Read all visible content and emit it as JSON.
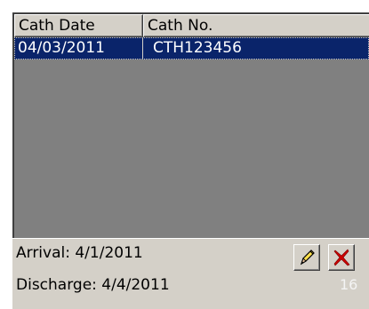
{
  "list": {
    "columns": [
      "Cath Date",
      "Cath No."
    ],
    "rows": [
      {
        "cath_date": "04/03/2011",
        "cath_no": "CTH123456"
      }
    ]
  },
  "panel": {
    "arrival": "Arrival: 4/1/2011",
    "discharge": "Discharge: 4/4/2011",
    "count": "16",
    "edit_icon": "pencil-icon",
    "delete_icon": "red-x-icon"
  },
  "colors": {
    "selection": "#0a246a",
    "list_background": "#808080",
    "panel_background": "#d4d0c8",
    "delete": "#cc0000"
  }
}
